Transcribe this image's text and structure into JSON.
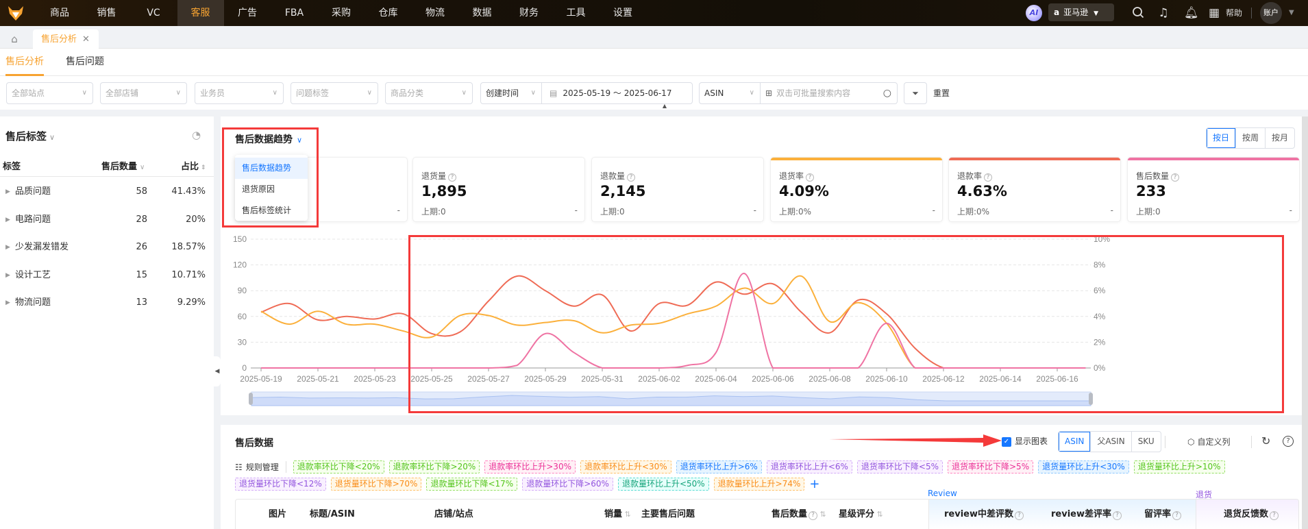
{
  "topnav": {
    "items": [
      "商品",
      "销售",
      "VC",
      "客服",
      "广告",
      "FBA",
      "采购",
      "仓库",
      "物流",
      "数据",
      "财务",
      "工具",
      "设置"
    ],
    "active": "客服",
    "ai_label": "AI",
    "platform": "亚马逊",
    "help": "帮助",
    "account": "账户"
  },
  "tabs": {
    "page_tab": "售后分析",
    "close": "✕"
  },
  "subtabs": [
    "售后分析",
    "售后问题"
  ],
  "filters": {
    "site": "全部站点",
    "store": "全部店铺",
    "salesperson": "业务员",
    "issue_tag": "问题标签",
    "category": "商品分类",
    "time_type": "创建时间",
    "date_range": "2025-05-19 ～ 2025-06-17",
    "search_type": "ASIN",
    "search_placeholder": "双击可批量搜索内容",
    "reset": "重置"
  },
  "left_panel": {
    "title": "售后标签",
    "headers": {
      "tag": "标签",
      "count": "售后数量",
      "ratio": "占比"
    },
    "rows": [
      {
        "name": "品质问题",
        "count": "58",
        "ratio": "41.43%"
      },
      {
        "name": "电路问题",
        "count": "28",
        "ratio": "20%"
      },
      {
        "name": "少发漏发错发",
        "count": "26",
        "ratio": "18.57%"
      },
      {
        "name": "设计工艺",
        "count": "15",
        "ratio": "10.71%"
      },
      {
        "name": "物流问题",
        "count": "13",
        "ratio": "9.29%"
      }
    ]
  },
  "trend": {
    "title": "售后数据趋势",
    "dropdown": [
      "售后数据趋势",
      "退货原因",
      "售后标签统计"
    ],
    "granularity": [
      "按日",
      "按周",
      "按月"
    ],
    "granularity_active": "按日",
    "kpis": [
      {
        "label": "",
        "value": "",
        "prev": "",
        "change": "-",
        "color": ""
      },
      {
        "label": "退货量",
        "value": "1,895",
        "prev": "上期:0",
        "change": "-",
        "color": ""
      },
      {
        "label": "退款量",
        "value": "2,145",
        "prev": "上期:0",
        "change": "-",
        "color": ""
      },
      {
        "label": "退货率",
        "value": "4.09%",
        "prev": "上期:0%",
        "change": "-",
        "color": "#fbb03b"
      },
      {
        "label": "退款率",
        "value": "4.63%",
        "prev": "上期:0%",
        "change": "-",
        "color": "#ef6b55"
      },
      {
        "label": "售后数量",
        "value": "233",
        "prev": "上期:0",
        "change": "-",
        "color": "#ef73a3"
      }
    ]
  },
  "chart_data": {
    "type": "line",
    "x": [
      "2025-05-19",
      "2025-05-20",
      "2025-05-21",
      "2025-05-22",
      "2025-05-23",
      "2025-05-24",
      "2025-05-25",
      "2025-05-26",
      "2025-05-27",
      "2025-05-28",
      "2025-05-29",
      "2025-05-30",
      "2025-05-31",
      "2025-06-01",
      "2025-06-02",
      "2025-06-03",
      "2025-06-04",
      "2025-06-05",
      "2025-06-06",
      "2025-06-07",
      "2025-06-08",
      "2025-06-09",
      "2025-06-10",
      "2025-06-11",
      "2025-06-12",
      "2025-06-13",
      "2025-06-14",
      "2025-06-15",
      "2025-06-16",
      "2025-06-17"
    ],
    "x_tick_labels": [
      "2025-05-19",
      "2025-05-21",
      "2025-05-23",
      "2025-05-25",
      "2025-05-27",
      "2025-05-29",
      "2025-05-31",
      "2025-06-02",
      "2025-06-04",
      "2025-06-06",
      "2025-06-08",
      "2025-06-10",
      "2025-06-12",
      "2025-06-14",
      "2025-06-16"
    ],
    "y_left": {
      "ticks": [
        "0",
        "30",
        "60",
        "90",
        "120",
        "150"
      ],
      "range": [
        0,
        150
      ]
    },
    "y_right": {
      "ticks": [
        "0%",
        "2%",
        "4%",
        "6%",
        "8%",
        "10%"
      ],
      "range": [
        0,
        10
      ]
    },
    "grid": true,
    "series": [
      {
        "name": "退款率",
        "axis": "right",
        "color": "#ef6b55",
        "values": [
          4.33,
          5.0,
          3.73,
          4.0,
          3.8,
          4.2,
          2.67,
          2.8,
          5.2,
          7.13,
          6.0,
          4.8,
          5.67,
          2.87,
          5.0,
          4.87,
          6.67,
          5.73,
          6.53,
          4.33,
          2.73,
          5.27,
          4.2,
          1.53,
          0,
          0,
          0,
          0,
          0,
          0
        ]
      },
      {
        "name": "退货率",
        "axis": "right",
        "color": "#fbb03b",
        "values": [
          4.4,
          3.4,
          4.4,
          3.4,
          3.4,
          2.87,
          2.4,
          4.07,
          4.07,
          3.33,
          3.53,
          3.67,
          2.73,
          3.33,
          3.47,
          4.2,
          4.8,
          6.2,
          5.0,
          7.13,
          3.6,
          5.07,
          3.47,
          0,
          0,
          0,
          0,
          0,
          0,
          0
        ]
      },
      {
        "name": "售后数量",
        "axis": "left",
        "color": "#ef73a3",
        "values": [
          0,
          0,
          0,
          0,
          0,
          0,
          0,
          0,
          0,
          3,
          40,
          18,
          0,
          0,
          0,
          3,
          18,
          110,
          0,
          0,
          0,
          0,
          52,
          0,
          0,
          0,
          0,
          0,
          0,
          0
        ]
      }
    ]
  },
  "data_section": {
    "title": "售后数据",
    "show_chart": "显示图表",
    "dimensions": [
      "ASIN",
      "父ASIN",
      "SKU"
    ],
    "dimension_active": "ASIN",
    "custom_columns": "自定义列",
    "rules": "规则管理",
    "tags_row1": [
      {
        "text": "退款率环比下降<20%",
        "tone": "green"
      },
      {
        "text": "退款率环比下降>20%",
        "tone": "green"
      },
      {
        "text": "退款率环比上升>30%",
        "tone": "pink"
      },
      {
        "text": "退款率环比上升<30%",
        "tone": "orange"
      },
      {
        "text": "退货率环比上升>6%",
        "tone": "blue"
      },
      {
        "text": "退货率环比上升<6%",
        "tone": "purple"
      },
      {
        "text": "退货率环比下降<5%",
        "tone": "purple"
      },
      {
        "text": "退货率环比下降>5%",
        "tone": "pink"
      },
      {
        "text": "退货量环比上升<30%",
        "tone": "blue"
      },
      {
        "text": "退货量环比上升>10%",
        "tone": "green"
      }
    ],
    "tags_row2": [
      {
        "text": "退货量环比下降<12%",
        "tone": "purple"
      },
      {
        "text": "退货量环比下降>70%",
        "tone": "orange"
      },
      {
        "text": "退款量环比下降<17%",
        "tone": "green"
      },
      {
        "text": "退款量环比下降>60%",
        "tone": "purple"
      },
      {
        "text": "退款量环比上升<50%",
        "tone": "teal"
      },
      {
        "text": "退款量环比上升>74%",
        "tone": "orange"
      }
    ],
    "add": "+",
    "group_review": "Review",
    "group_return": "退货",
    "columns": [
      "图片",
      "标题/ASIN",
      "店铺/站点",
      "销量",
      "主要售后问题",
      "售后数量",
      "星级评分",
      "review中差评数",
      "review差评率",
      "留评率",
      "退货反馈数"
    ]
  }
}
